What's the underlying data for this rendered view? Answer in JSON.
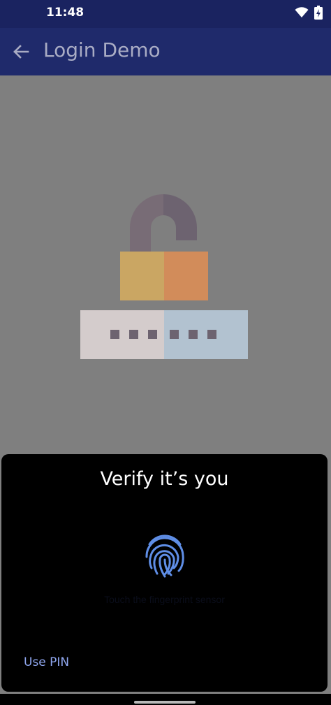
{
  "status_bar": {
    "time": "11:48",
    "icons": [
      "wifi-icon",
      "battery-icon"
    ]
  },
  "app_bar": {
    "title": "Login Demo",
    "back_icon": "arrow-left-icon"
  },
  "illustration": {
    "name": "unlocked-padlock-password"
  },
  "auth_sheet": {
    "title": "Verify it’s you",
    "fingerprint_icon": "fingerprint-icon",
    "hint": "Touch the fingerprint sensor",
    "use_pin_label": "Use PIN"
  },
  "colors": {
    "status_bar": "#1a2360",
    "app_bar": "#1f2a6b",
    "scrim": "#7f7f7f",
    "sheet": "#000000",
    "accent": "#8fa6ee",
    "fingerprint": "#5f8ee6"
  }
}
